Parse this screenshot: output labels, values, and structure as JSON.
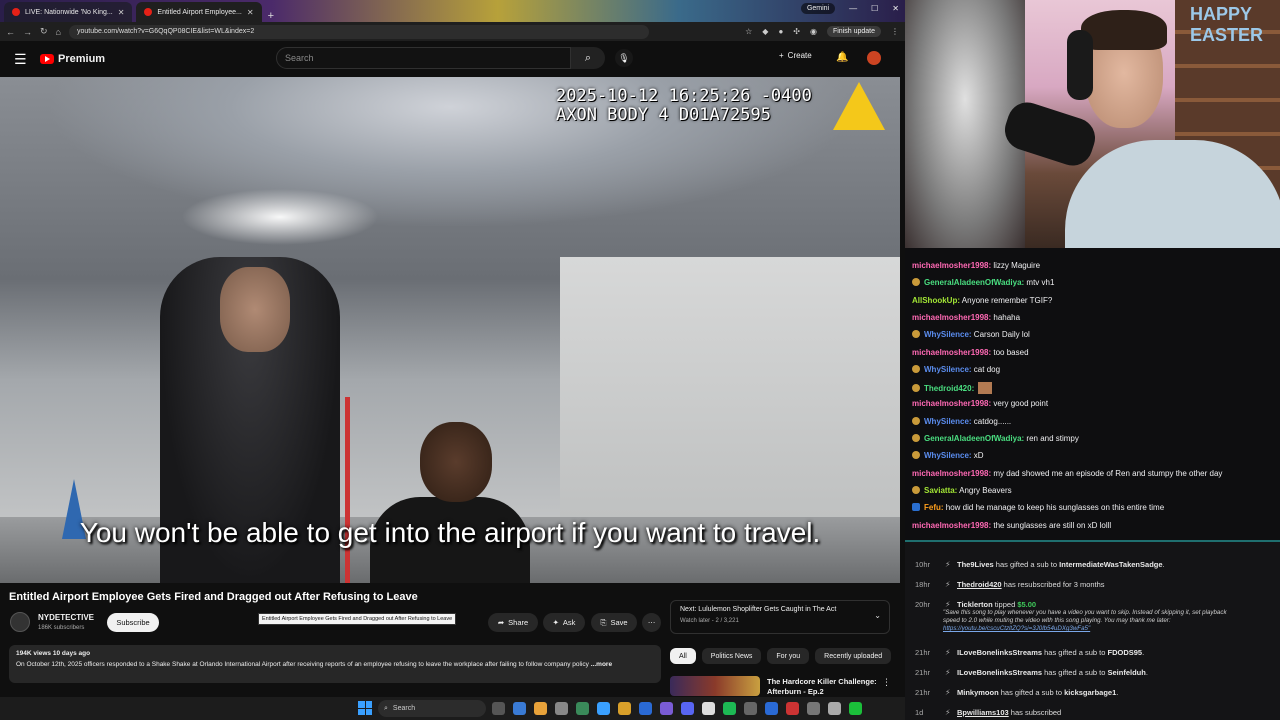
{
  "browser": {
    "tabs": [
      {
        "label": "LIVE: Nationwide 'No King...",
        "active": false
      },
      {
        "label": "Entitled Airport Employee...",
        "active": true
      }
    ],
    "gemini_label": "Gemini",
    "url": "youtube.com/watch?v=G6QqQP08CIE&list=WL&index=2",
    "finish_update": "Finish update"
  },
  "youtube": {
    "brand": "Premium",
    "search_placeholder": "Search",
    "create_label": "Create",
    "video": {
      "timestamp": "2025-10-12 16:25:26 -0400\nAXON BODY 4 D01A72595",
      "caption": "You won't be able to get into the airport if you want to travel.",
      "title": "Entitled Airport Employee Gets Fired and Dragged out After Refusing to Leave",
      "tooltip": "Entitled Airport Employee Gets Fired and Dragged out After Refusing to Leave",
      "channel": "NYDETECTIVE",
      "subscribers": "186K subscribers",
      "subscribe_label": "Subscribe",
      "share_label": "Share",
      "ask_label": "Ask",
      "save_label": "Save",
      "views_date": "194K views  10 days ago",
      "description": "On October 12th, 2025 officers responded to a Shake Shake at Orlando International Airport after receiving reports of an employee refusing to leave the workplace after failing to follow company policy",
      "more_label": "...more"
    },
    "next": {
      "label": "Next: Lululemon Shoplifter Gets Caught in The Act",
      "sub": "Watch later - 2 / 3,221"
    },
    "chips": [
      "All",
      "Politics News",
      "For you",
      "Recently uploaded"
    ],
    "recommended": {
      "title": "The Hardcore Killer Challenge: Afterburn - Ep.2"
    }
  },
  "taskbar": {
    "search": "Search"
  },
  "webcam": {
    "sign": "HAPPY EASTER"
  },
  "chat": [
    {
      "user": "michaelmosher1998",
      "text": "lizzy Maguire",
      "color": "pink",
      "badge": false
    },
    {
      "user": "GeneralAladeenOfWadiya",
      "text": "mtv vh1",
      "color": "green",
      "badge": true
    },
    {
      "user": "AllShookUp",
      "text": "Anyone remember TGIF?",
      "color": "lime",
      "badge": false
    },
    {
      "user": "michaelmosher1998",
      "text": "hahaha",
      "color": "pink",
      "badge": false
    },
    {
      "user": "WhySilence",
      "text": "Carson Daily lol",
      "color": "blue",
      "badge": true
    },
    {
      "user": "michaelmosher1998",
      "text": "too based",
      "color": "pink",
      "badge": false
    },
    {
      "user": "WhySilence",
      "text": "cat dog",
      "color": "blue",
      "badge": true
    },
    {
      "user": "Thedroid420",
      "text": "",
      "color": "green",
      "badge": true,
      "emote": true
    },
    {
      "user": "michaelmosher1998",
      "text": "very good point",
      "color": "pink",
      "badge": false
    },
    {
      "user": "WhySilence",
      "text": "catdog......",
      "color": "blue",
      "badge": true
    },
    {
      "user": "GeneralAladeenOfWadiya",
      "text": "ren and stimpy",
      "color": "green",
      "badge": true
    },
    {
      "user": "WhySilence",
      "text": "xD",
      "color": "blue",
      "badge": true
    },
    {
      "user": "michaelmosher1998",
      "text": "my dad showed me an episode of Ren and stumpy the other day",
      "color": "pink",
      "badge": false
    },
    {
      "user": "Saviatta",
      "text": "Angry Beavers",
      "color": "lime",
      "badge": true
    },
    {
      "user": "Fefu",
      "text": "how did he manage to keep his sunglasses on this entire time",
      "color": "orange",
      "badge": true,
      "blue": true
    },
    {
      "user": "michaelmosher1998",
      "text": "the sunglasses are still on xD lolll",
      "color": "pink",
      "badge": false
    }
  ],
  "events": [
    {
      "time": "10hr",
      "user": "The9Lives",
      "text": "has gifted a sub to",
      "target": "IntermediateWasTakenSadge",
      "suffix": "."
    },
    {
      "time": "18hr",
      "user": "Thedroid420",
      "text": "has resubscribed for 3 months",
      "target": "",
      "suffix": ""
    },
    {
      "time": "20hr",
      "user": "Ticklerton",
      "text": "tipped",
      "amount": "$5.00",
      "note": "\"Save this song to play whenever you have a video you want to skip. Instead of skipping it, set playback speed to 2.0 while muting the video with this song playing. You may thank me later:",
      "link": "https://youtu.be/cscuCtzltZQ?si=3J0lb54uDXg3wFa5\""
    },
    {
      "time": "21hr",
      "user": "ILoveBonelinksStreams",
      "text": "has gifted a sub to",
      "target": "FDODS95",
      "suffix": "."
    },
    {
      "time": "21hr",
      "user": "ILoveBonelinksStreams",
      "text": "has gifted a sub to",
      "target": "Seinfelduh",
      "suffix": "."
    },
    {
      "time": "21hr",
      "user": "Minkymoon",
      "text": "has gifted a sub to",
      "target": "kicksgarbage1",
      "suffix": "."
    },
    {
      "time": "1d",
      "user": "Bpwilliams103",
      "text": "has subscribed",
      "target": "",
      "suffix": ""
    }
  ]
}
